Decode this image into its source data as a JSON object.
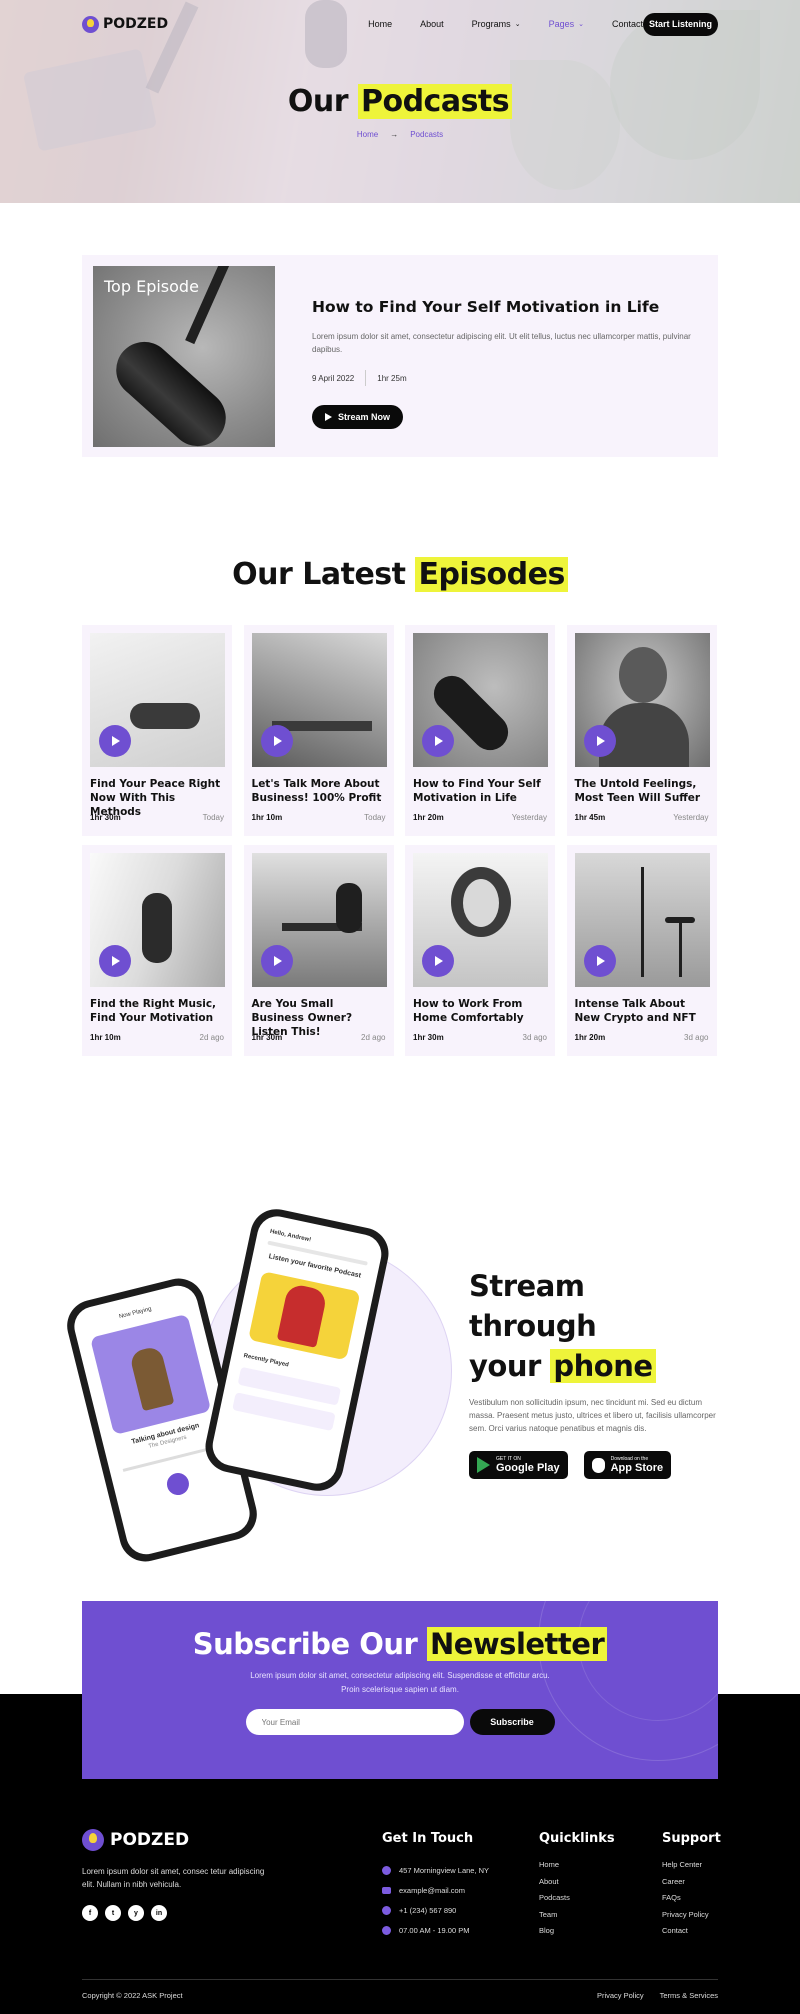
{
  "brand": {
    "name": "PODZED"
  },
  "nav": {
    "items": [
      {
        "label": "Home"
      },
      {
        "label": "About"
      },
      {
        "label": "Programs"
      },
      {
        "label": "Pages"
      },
      {
        "label": "Contact"
      }
    ],
    "cta": "Start Listening"
  },
  "hero": {
    "title_plain": "Our",
    "title_highlight": "Podcasts",
    "breadcrumb": [
      "Home",
      "Podcasts"
    ]
  },
  "top_episode": {
    "badge": "Top Episode",
    "title": "How to Find Your Self Motivation in Life",
    "description": "Lorem ipsum dolor sit amet, consectetur adipiscing elit. Ut elit tellus, luctus nec ullamcorper mattis, pulvinar dapibus.",
    "date": "9 April 2022",
    "duration": "1hr 25m",
    "button": "Stream Now"
  },
  "latest": {
    "title_plain": "Our Latest",
    "title_highlight": "Episodes",
    "episodes": [
      {
        "title": "Find Your Peace Right Now With This Methods",
        "duration": "1hr 30m",
        "when": "Today"
      },
      {
        "title": "Let's Talk More About Business! 100% Profit",
        "duration": "1hr 10m",
        "when": "Today"
      },
      {
        "title": "How to Find Your Self Motivation in Life",
        "duration": "1hr 20m",
        "when": "Yesterday"
      },
      {
        "title": "The Untold Feelings, Most Teen Will Suffer",
        "duration": "1hr 45m",
        "when": "Yesterday"
      },
      {
        "title": "Find the Right Music, Find Your Motivation",
        "duration": "1hr 10m",
        "when": "2d ago"
      },
      {
        "title": "Are You Small Business Owner? Listen This!",
        "duration": "1hr 30m",
        "when": "2d ago"
      },
      {
        "title": "How to Work From Home Comfortably",
        "duration": "1hr 30m",
        "when": "3d ago"
      },
      {
        "title": "Intense Talk About New Crypto and NFT",
        "duration": "1hr 20m",
        "when": "3d ago"
      }
    ]
  },
  "app": {
    "title_line1": "Stream through",
    "title_plain": "your",
    "title_highlight": "phone",
    "description": "Vestibulum non sollicitudin ipsum, nec tincidunt mi. Sed eu dictum massa. Praesent metus justo, ultrices et libero ut, facilisis ullamcorper sem. Orci varius natoque penatibus et magnis dis.",
    "google": {
      "small": "GET IT ON",
      "big": "Google Play"
    },
    "apple": {
      "small": "Download on the",
      "big": "App Store"
    },
    "phone1": {
      "screen_title": "Now Playing",
      "track": "Talking about design",
      "artist": "The Designers"
    },
    "phone2": {
      "greeting": "Hello, Andrew!",
      "search": "Search",
      "heading": "Listen your favorite Podcast",
      "section": "Recently Played"
    }
  },
  "newsletter": {
    "title_plain": "Subscribe Our",
    "title_highlight": "Newsletter",
    "text": "Lorem ipsum dolor sit amet, consectetur adipiscing elit. Suspendisse et efficitur arcu. Proin scelerisque sapien ut diam.",
    "placeholder": "Your Email",
    "button": "Subscribe"
  },
  "footer": {
    "about": "Lorem ipsum dolor sit amet, consec tetur adipiscing elit. Nullam in nibh vehicula.",
    "socials": [
      "f",
      "t",
      "y",
      "in"
    ],
    "contact": {
      "title": "Get In Touch",
      "address": "457 Morningview Lane, NY",
      "email": "example@mail.com",
      "phone": "+1 (234) 567 890",
      "hours": "07.00 AM - 19.00 PM"
    },
    "quicklinks": {
      "title": "Quicklinks",
      "items": [
        "Home",
        "About",
        "Podcasts",
        "Team",
        "Blog"
      ]
    },
    "support": {
      "title": "Support",
      "items": [
        "Help Center",
        "Career",
        "FAQs",
        "Privacy Policy",
        "Contact"
      ]
    },
    "copyright": "Copyright © 2022 ASK Project",
    "legal": [
      "Privacy Policy",
      "Terms & Services"
    ]
  },
  "colors": {
    "accent": "#6f4fd1",
    "highlight": "#eef43a",
    "card_bg": "#f8f3fc",
    "dark": "#0a0a0a"
  }
}
